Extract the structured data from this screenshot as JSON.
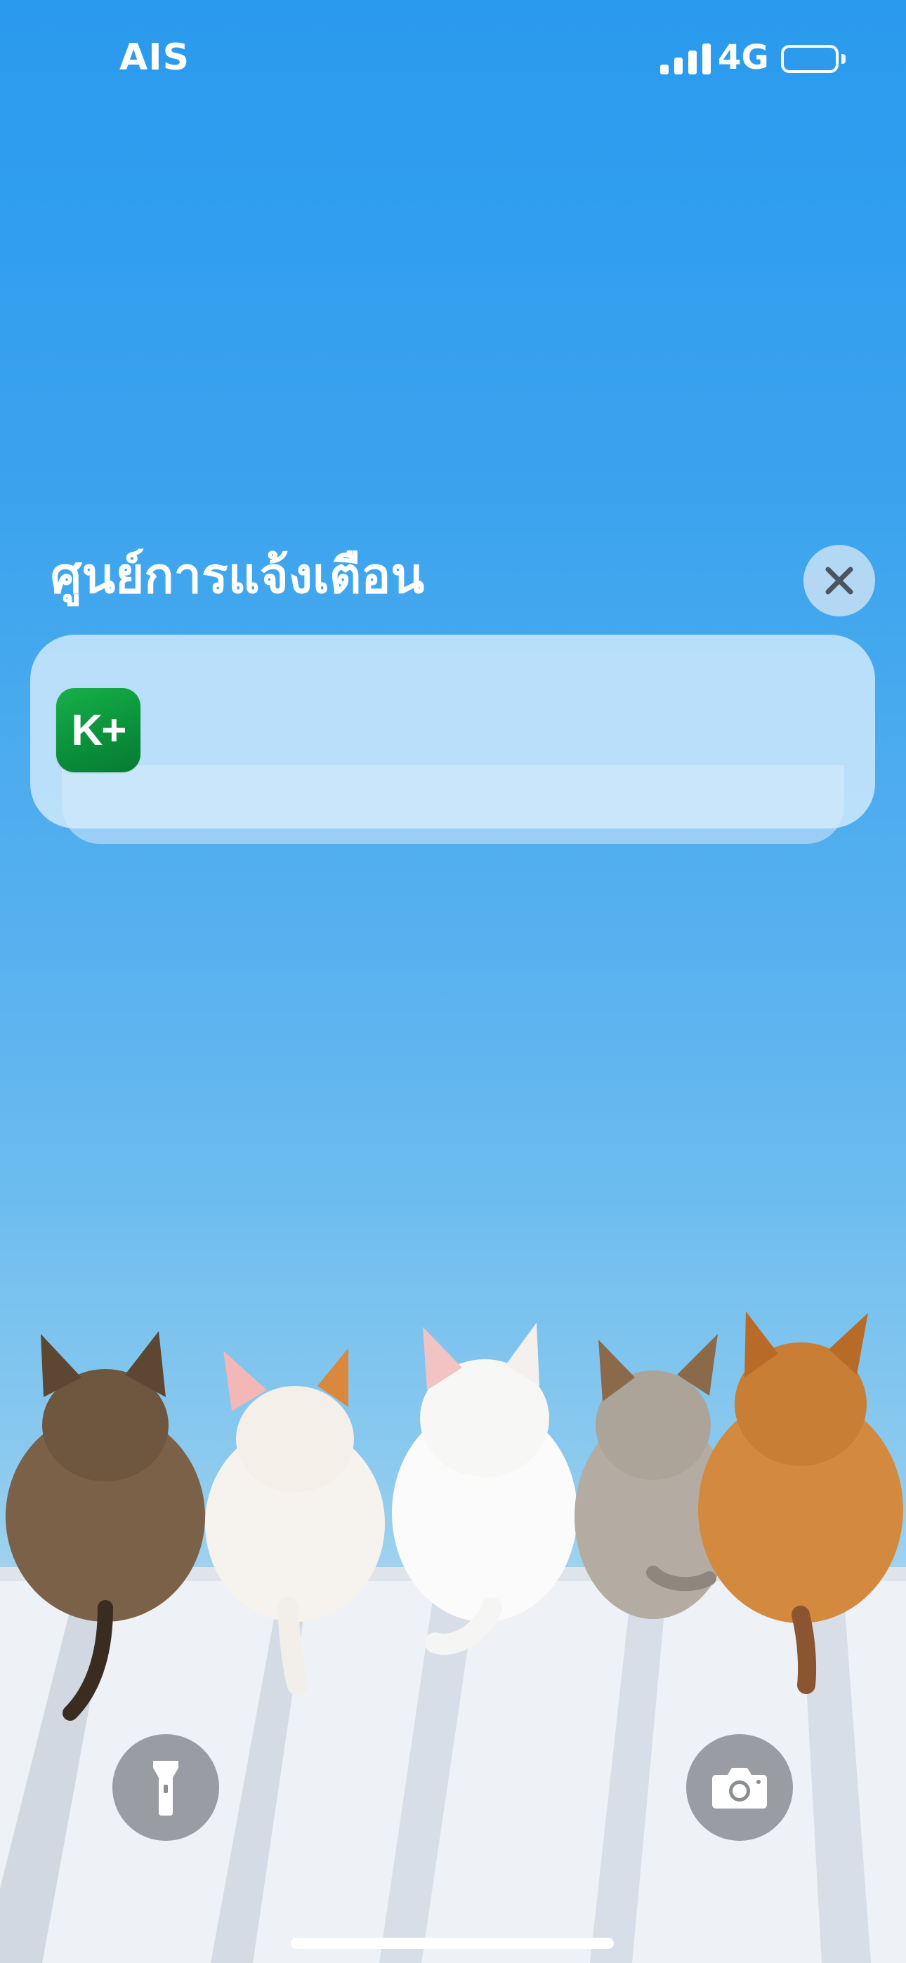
{
  "status_bar": {
    "carrier": "AIS",
    "network": "4G",
    "signal_bars": 4,
    "battery_icon": "battery-icon"
  },
  "notification_center": {
    "title": "ศูนย์การแจ้งเตือน",
    "close_icon": "close-icon",
    "notification": {
      "app_icon_text": "K+",
      "app_icon_color": "#12a444"
    }
  },
  "lock_screen": {
    "flashlight_icon": "flashlight-icon",
    "camera_icon": "camera-icon"
  },
  "colors": {
    "sky_top": "#2a9aee",
    "sky_bottom": "#a6d5ef",
    "wall": "#f2f4f7"
  }
}
